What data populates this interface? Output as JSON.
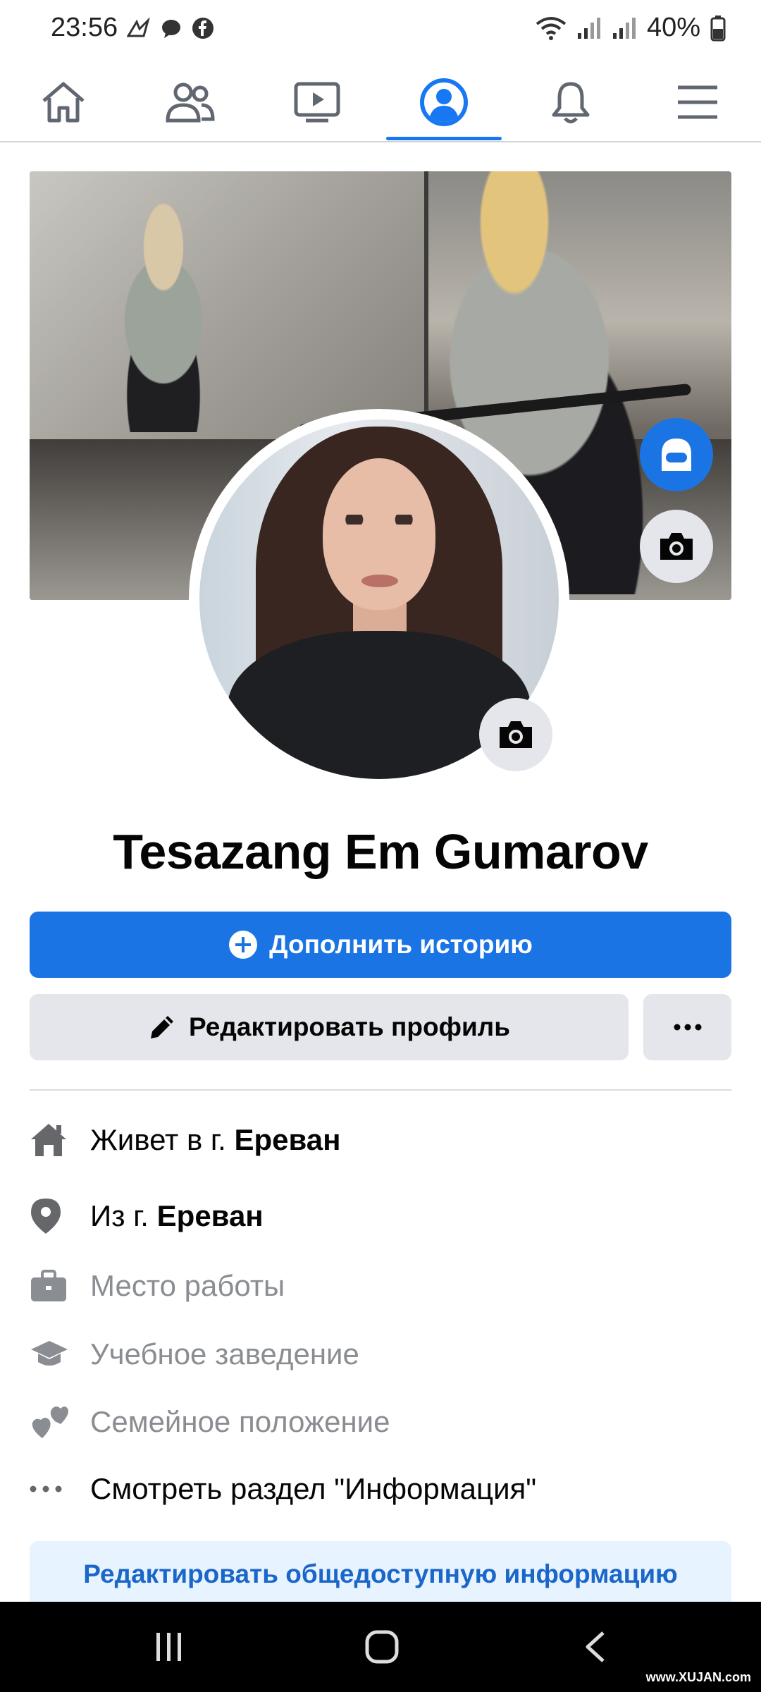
{
  "status_bar": {
    "time": "23:56",
    "battery": "40%",
    "icons": [
      "wheel-of-fortune-icon",
      "messenger-icon",
      "facebook-icon",
      "wifi-icon",
      "signal-icon",
      "signal-icon",
      "battery-icon"
    ]
  },
  "nav": {
    "tabs": [
      {
        "name": "home",
        "icon": "home-icon",
        "active": false
      },
      {
        "name": "friends",
        "icon": "friends-icon",
        "active": false
      },
      {
        "name": "watch",
        "icon": "video-icon",
        "active": false
      },
      {
        "name": "profile",
        "icon": "profile-icon",
        "active": true
      },
      {
        "name": "notifications",
        "icon": "bell-icon",
        "active": false
      },
      {
        "name": "menu",
        "icon": "hamburger-icon",
        "active": false
      }
    ],
    "accent": "#1877f2"
  },
  "profile": {
    "name": "Tesazang Em Gumarov"
  },
  "actions": {
    "add_story": "Дополнить историю",
    "edit_profile": "Редактировать профиль",
    "more": "···"
  },
  "info": {
    "lives_in_prefix": "Живет в г.",
    "lives_in_city": "Ереван",
    "from_prefix": "Из г.",
    "from_city": "Ереван",
    "workplace": "Место работы",
    "education": "Учебное заведение",
    "relationship": "Семейное положение",
    "see_about": "Смотреть раздел \"Информация\"",
    "edit_public": "Редактировать общедоступную информацию"
  },
  "watermark": "www.XUJAN.com",
  "colors": {
    "primary_button": "#1b74e4",
    "secondary_button": "#e4e6eb",
    "light_button": "#e7f3ff",
    "light_button_text": "#1b66c9",
    "muted_text": "#8a8d91"
  }
}
